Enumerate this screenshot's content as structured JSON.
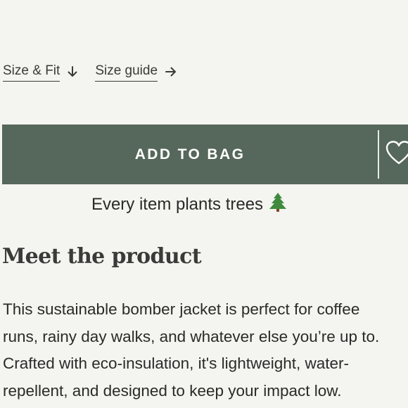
{
  "links": {
    "size_fit": "Size & Fit",
    "size_guide": "Size guide"
  },
  "cta": {
    "add_to_bag": "ADD TO BAG"
  },
  "promo": {
    "text": "Every item plants trees"
  },
  "section": {
    "heading": "Meet the product",
    "description_lines": [
      "This sustainable bomber jacket is perfect for coffee",
      "runs, rainy day walks, and whatever else you’re up to.",
      "Crafted with eco-insulation, it's lightweight, water-",
      "repellent, and designed to keep your impact low."
    ]
  },
  "icons": {
    "size_fit": "arrow-down-icon",
    "size_guide": "arrow-right-icon",
    "wishlist": "heart-icon",
    "promo": "evergreen-tree-icon"
  },
  "colors": {
    "background": "#f4f4f1",
    "button": "#56675b",
    "button_text": "#ffffff",
    "text": "#2a2a28"
  }
}
